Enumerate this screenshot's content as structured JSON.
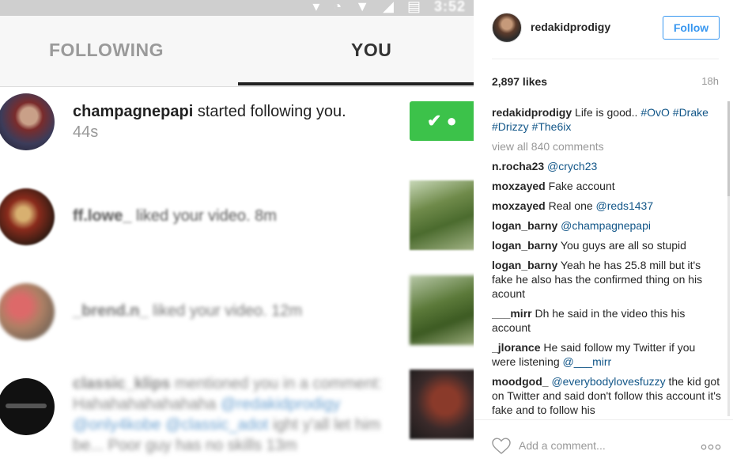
{
  "photo": {
    "status_time": "3:52",
    "tabs": {
      "following": "FOLLOWING",
      "you": "YOU"
    },
    "notifications": [
      {
        "user": "champagnepapi",
        "action": "started following you.",
        "ago": "44s"
      },
      {
        "user": "ff.lowe_",
        "action": "liked your video.",
        "ago": "8m"
      },
      {
        "user": "_brend.n_",
        "action": "liked your video.",
        "ago": "12m"
      },
      {
        "user": "classic_klips",
        "action": "mentioned you in a comment: Hahahahahahahaha",
        "mentions": "@redakidprodigy @only4kobe @classic_adot",
        "tail": "ight y'all let him be... Poor guy has no skills",
        "ago": "13m"
      }
    ]
  },
  "post": {
    "username": "redakidprodigy",
    "follow_label": "Follow",
    "likes": "2,897 likes",
    "time_ago": "18h",
    "caption_text": "Life is good..",
    "caption_tags": [
      "#OvO",
      "#Drake",
      "#Drizzy",
      "#The6ix"
    ],
    "view_all": "view all 840 comments",
    "comments": [
      {
        "user": "n.rocha23",
        "text": "",
        "tag": "@crych23"
      },
      {
        "user": "moxzayed",
        "text": "Fake account",
        "tag": ""
      },
      {
        "user": "moxzayed",
        "text": "Real one",
        "tag": "@reds1437"
      },
      {
        "user": "logan_barny",
        "text": "",
        "tag": "@champagnepapi"
      },
      {
        "user": "logan_barny",
        "text": "You guys are all so stupid",
        "tag": ""
      },
      {
        "user": "logan_barny",
        "text": "Yeah he has 25.8 mill but it's fake he also has the confirmed thing on his acount",
        "tag": ""
      },
      {
        "user": "___mirr",
        "text": "Dh he said in the video this his account",
        "tag": ""
      },
      {
        "user": "_jlorance",
        "text": "He said follow my Twitter if you were listening",
        "tag": "@___mirr"
      },
      {
        "user": "moodgod_",
        "text": "the kid got on Twitter and said don't follow this account it's fake and to follow his",
        "tag": "@everybodylovesfuzzy",
        "tag_first": true
      }
    ],
    "add_comment_placeholder": "Add a comment..."
  },
  "colors": {
    "follow_blue": "#3897f0",
    "tag_blue": "#125688",
    "follow_back_green": "#3cc24a"
  },
  "icons": [
    "heart-icon",
    "more-options-icon",
    "follow-back-icon"
  ]
}
